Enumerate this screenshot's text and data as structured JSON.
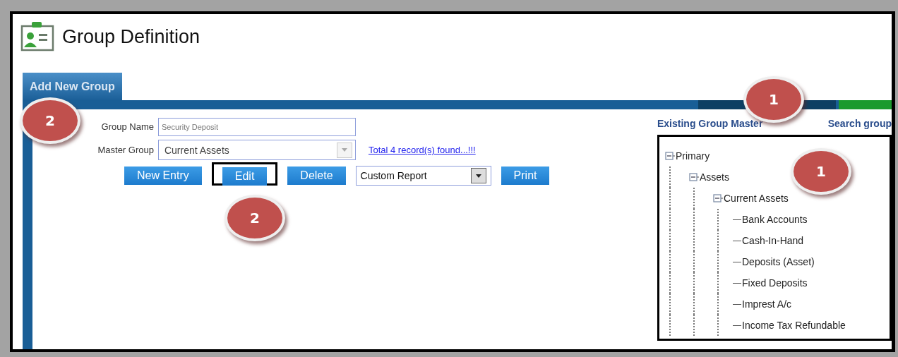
{
  "window": {
    "title": "Group Definition"
  },
  "tabs": [
    {
      "label": "Add New Group",
      "selected": true
    }
  ],
  "form": {
    "group_name": {
      "label": "Group Name",
      "value": "Security Deposit"
    },
    "master_group": {
      "label": "Master Group",
      "value": "Current Assets"
    },
    "records_link": "Total 4 record(s) found...!!!"
  },
  "buttons": [
    {
      "label": "New Entry",
      "highlighted": false
    },
    {
      "label": "Edit",
      "highlighted": true
    },
    {
      "label": "Delete",
      "highlighted": false
    }
  ],
  "report_select": {
    "value": "Custom Report"
  },
  "print_button": {
    "label": "Print"
  },
  "existing": {
    "title": "Existing Group Master",
    "search_link": "Search group",
    "highlighted": true
  },
  "tree": [
    {
      "label": "Primary",
      "expanded": true,
      "children": [
        {
          "label": "Assets",
          "expanded": true,
          "children": [
            {
              "label": "Current Assets",
              "expanded": true,
              "children": [
                {
                  "label": "Bank Accounts"
                },
                {
                  "label": "Cash-In-Hand"
                },
                {
                  "label": "Deposits (Asset)"
                },
                {
                  "label": "Fixed Deposits"
                },
                {
                  "label": "Imprest A/c"
                },
                {
                  "label": "Income Tax Refundable"
                }
              ]
            }
          ]
        }
      ]
    }
  ],
  "callouts": [
    {
      "label": "2"
    },
    {
      "label": "2"
    },
    {
      "label": "1"
    },
    {
      "label": "1"
    }
  ]
}
